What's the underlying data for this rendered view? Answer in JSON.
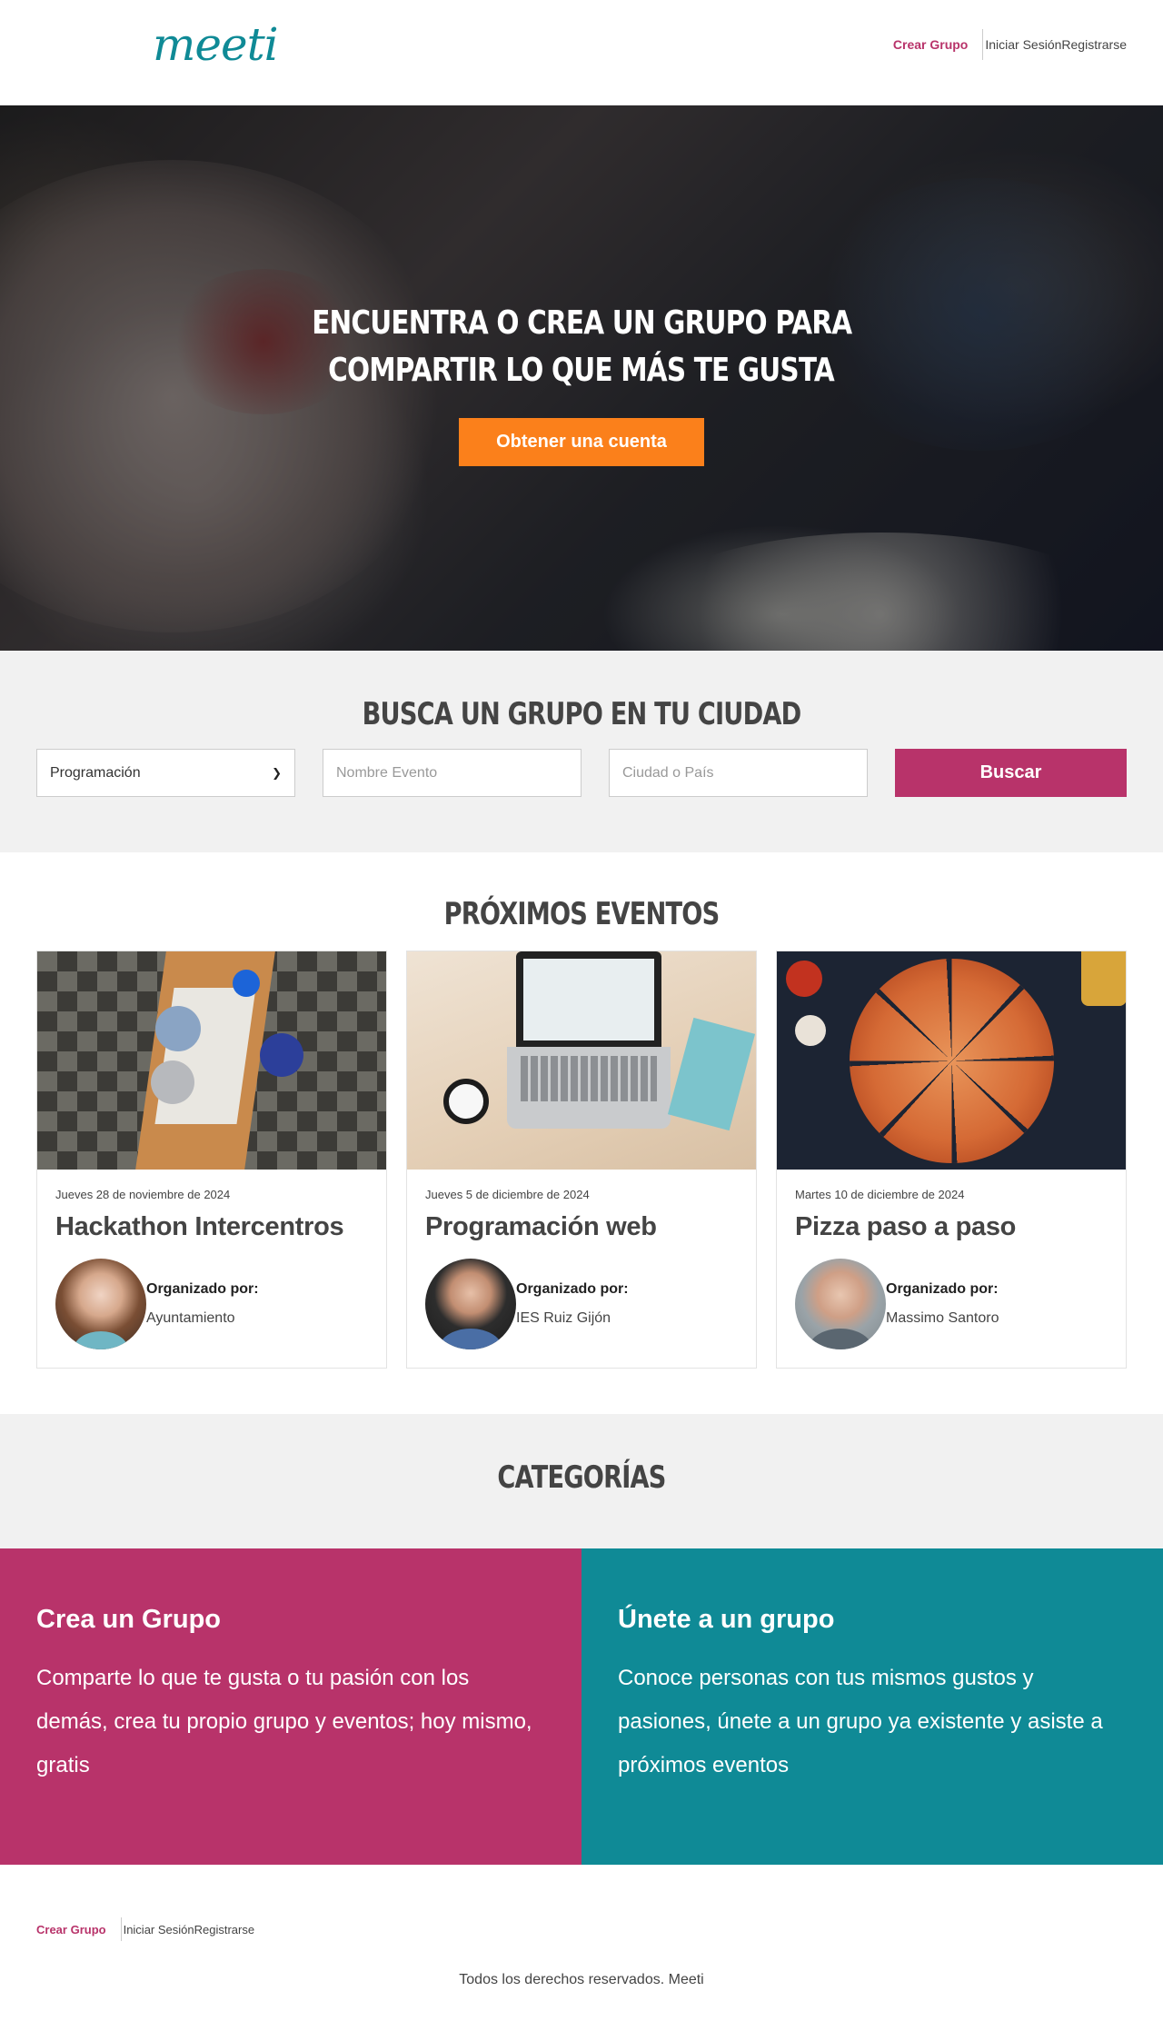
{
  "header": {
    "logo": "meeti",
    "nav": {
      "create": "Crear Grupo",
      "login": "Iniciar Sesión",
      "register": "Registrarse"
    }
  },
  "hero": {
    "title_line1": "Encuentra o crea un grupo para",
    "title_line2": "compartir lo que más te gusta",
    "cta": "Obtener una cuenta"
  },
  "search": {
    "title": "Busca un grupo en tu ciudad",
    "category_selected": "Programación",
    "event_placeholder": "Nombre Evento",
    "city_placeholder": "Ciudad o País",
    "button": "Buscar"
  },
  "events": {
    "title": "Próximos eventos",
    "items": [
      {
        "date": "Jueves 28 de noviembre de 2024",
        "title": "Hackathon Intercentros",
        "org_label": "Organizado por:",
        "organizer": "Ayuntamiento",
        "image_icon": "meeting-table-image",
        "avatar_icon": "woman-avatar"
      },
      {
        "date": "Jueves 5 de diciembre de 2024",
        "title": "Programación web",
        "org_label": "Organizado por:",
        "organizer": "IES Ruiz Gijón",
        "image_icon": "laptop-coffee-image",
        "avatar_icon": "man-glasses-avatar"
      },
      {
        "date": "Martes 10 de diciembre de 2024",
        "title": "Pizza paso a paso",
        "org_label": "Organizado por:",
        "organizer": "Massimo Santoro",
        "image_icon": "pizza-image",
        "avatar_icon": "bald-man-avatar"
      }
    ]
  },
  "categories": {
    "title": "Categorías",
    "items": [
      {
        "title": "Crea un Grupo",
        "text": "Comparte lo que te gusta o tu pasión con los demás, crea tu propio grupo y eventos; hoy mismo, gratis",
        "color": "#b8336a"
      },
      {
        "title": "Únete a un grupo",
        "text": "Conoce personas con tus mismos gustos y pasiones, únete a un grupo ya existente y asiste a próximos eventos",
        "color": "#0f8a96"
      }
    ]
  },
  "footer": {
    "nav": {
      "create": "Crear Grupo",
      "login": "Iniciar Sesión",
      "register": "Registrarse"
    },
    "copyright": "Todos los derechos reservados. Meeti"
  },
  "colors": {
    "brand_pink": "#b8336a",
    "brand_teal": "#0f8a96",
    "cta_orange": "#fb801b"
  }
}
